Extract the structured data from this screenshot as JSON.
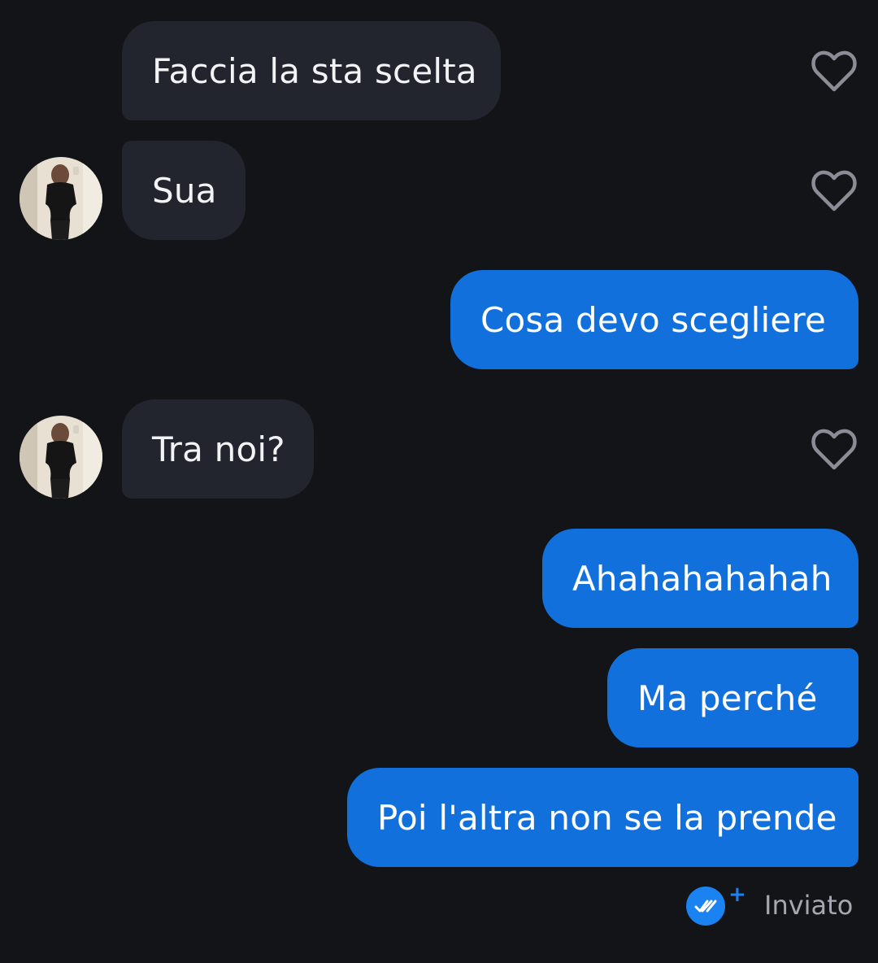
{
  "conversation": {
    "messages": [
      {
        "direction": "received",
        "text": "Faccia la sta scelta"
      },
      {
        "direction": "received",
        "text": "Sua"
      },
      {
        "direction": "sent",
        "text": "Cosa devo scegliere"
      },
      {
        "direction": "received",
        "text": "Tra noi?"
      },
      {
        "direction": "sent",
        "text": "Ahahahahahah"
      },
      {
        "direction": "sent",
        "text": "Ma perché"
      },
      {
        "direction": "sent",
        "text": "Poi l'altra non se la prende"
      }
    ],
    "status": {
      "label": "Inviato",
      "icon": "double-check-icon",
      "extra_icon": "plus-icon"
    }
  },
  "colors": {
    "background": "#121418",
    "received_bubble": "#22252e",
    "sent_bubble": "#1270dc",
    "heart_outline": "#8a8d96",
    "status_icon": "#1b82f2",
    "status_text": "#a5a8b0"
  }
}
